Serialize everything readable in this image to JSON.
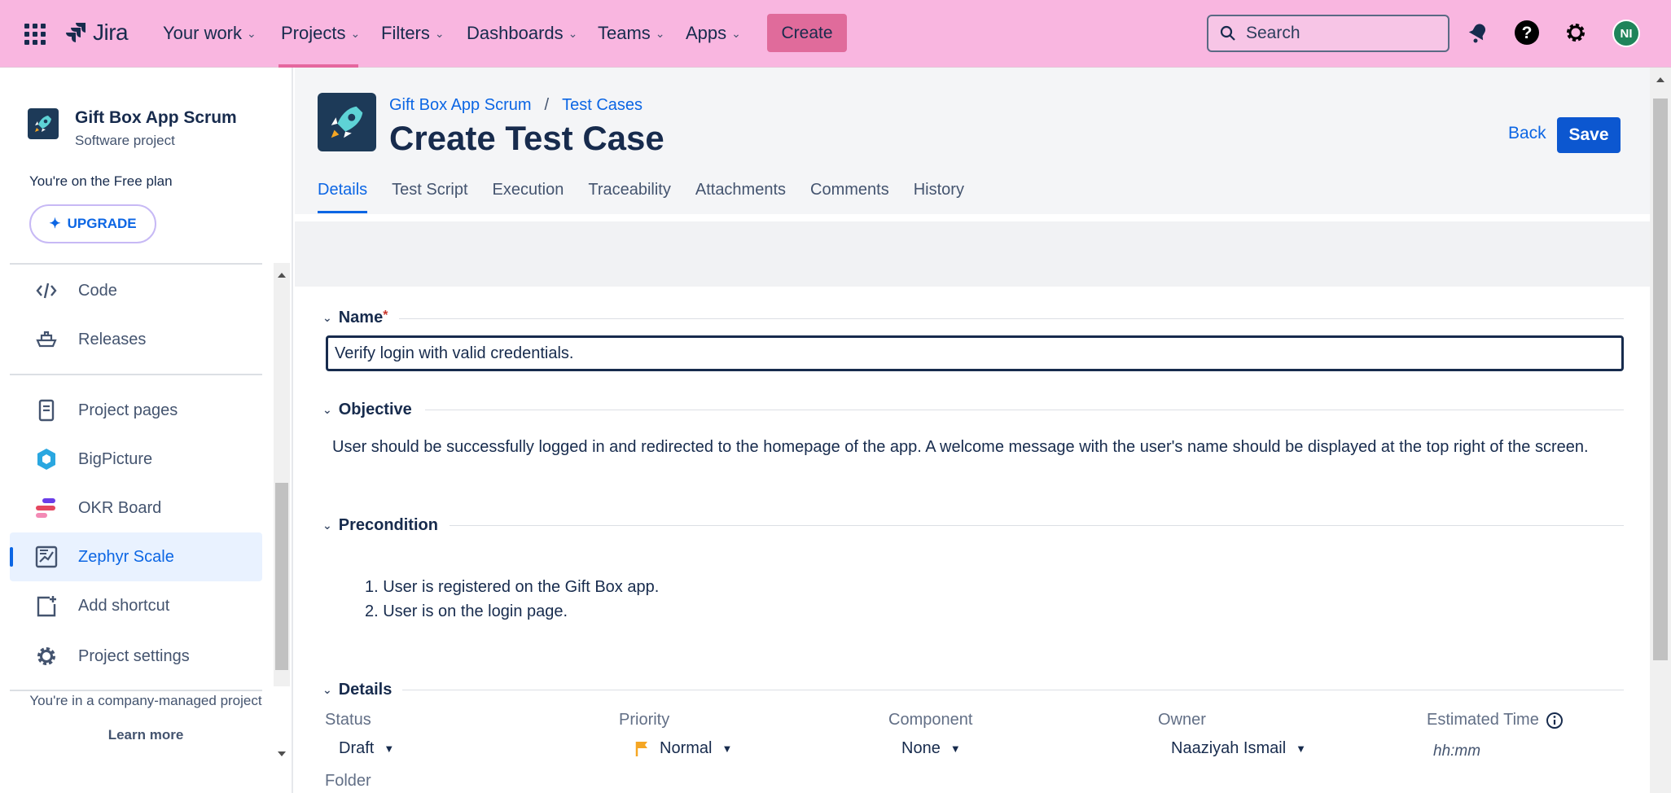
{
  "topnav": {
    "logo_text": "Jira",
    "items": [
      {
        "label": "Your work"
      },
      {
        "label": "Projects"
      },
      {
        "label": "Filters"
      },
      {
        "label": "Dashboards"
      },
      {
        "label": "Teams"
      },
      {
        "label": "Apps"
      }
    ],
    "create_label": "Create",
    "search_placeholder": "Search",
    "avatar_initials": "NI"
  },
  "sidebar": {
    "project_name": "Gift Box App Scrum",
    "project_type": "Software project",
    "plan_text": "You're on the Free plan",
    "upgrade_label": "UPGRADE",
    "items": [
      {
        "label": "Code"
      },
      {
        "label": "Releases"
      },
      {
        "label": "Project pages"
      },
      {
        "label": "BigPicture"
      },
      {
        "label": "OKR Board"
      },
      {
        "label": "Zephyr Scale"
      },
      {
        "label": "Add shortcut"
      },
      {
        "label": "Project settings"
      }
    ],
    "footer_text": "You're in a company-managed project",
    "learn_more": "Learn more"
  },
  "main": {
    "breadcrumb": [
      "Gift Box App Scrum",
      "Test Cases"
    ],
    "breadcrumb_sep": "/",
    "title": "Create Test Case",
    "back_label": "Back",
    "save_label": "Save",
    "tabs": [
      "Details",
      "Test Script",
      "Execution",
      "Traceability",
      "Attachments",
      "Comments",
      "History"
    ],
    "active_tab": "Details",
    "name_label": "Name",
    "name_required": "*",
    "name_value": "Verify login with valid credentials.",
    "objective_label": "Objective",
    "objective_text": "User should be successfully logged in and redirected to the homepage of the app. A welcome message with the user's name should be displayed at the top right of the screen.",
    "precondition_label": "Precondition",
    "preconditions": [
      "1. User is registered on the Gift Box app.",
      "2. User is on the login page."
    ],
    "details_label": "Details",
    "fields": {
      "status_label": "Status",
      "status_value": "Draft",
      "priority_label": "Priority",
      "priority_value": "Normal",
      "component_label": "Component",
      "component_value": "None",
      "owner_label": "Owner",
      "owner_value": "Naaziyah Ismail",
      "estimated_label": "Estimated Time",
      "estimated_placeholder": "hh:mm",
      "folder_label": "Folder"
    }
  },
  "colors": {
    "nav_bg": "#f9b6e0",
    "accent": "#0c66e4",
    "create_btn": "#e06b9b",
    "priority_flag": "#f5a623"
  }
}
